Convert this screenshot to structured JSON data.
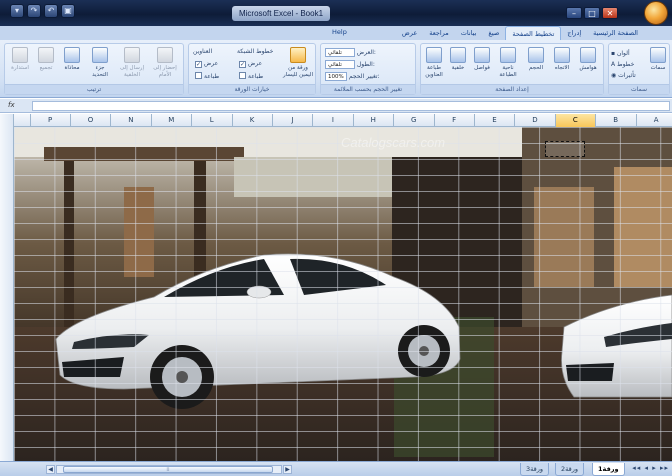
{
  "window": {
    "title": "Microsoft Excel - Book1",
    "title_visible": "Microsoft Excel - Book1"
  },
  "menu": {
    "help": "Help"
  },
  "tabs": [
    {
      "label": "الصفحة الرئيسية",
      "active": false
    },
    {
      "label": "إدراج",
      "active": false
    },
    {
      "label": "تخطيط الصفحة",
      "active": true
    },
    {
      "label": "صيغ",
      "active": false
    },
    {
      "label": "بيانات",
      "active": false
    },
    {
      "label": "مراجعة",
      "active": false
    },
    {
      "label": "عرض",
      "active": false
    }
  ],
  "ribbon": {
    "themes_group": {
      "label": "سمات",
      "btn_themes": "سمات",
      "colors": "ألوان",
      "fonts": "خطوط",
      "effects": "تأثيرات"
    },
    "page_setup": {
      "label": "إعداد الصفحة",
      "margins": "هوامش",
      "orientation": "الاتجاه",
      "size": "الحجم",
      "print_area": "ناحية الطباعة",
      "breaks": "فواصل",
      "background": "خلفية",
      "print_titles": "طباعة العناوين"
    },
    "scale": {
      "label": "تغيير الحجم بحسب الملائمة",
      "width_label": "العرض:",
      "width_value": "تلقائي",
      "height_label": "الطول:",
      "height_value": "تلقائي",
      "scale_label": "تغيير الحجم:",
      "scale_value": "100%"
    },
    "sheet_options": {
      "label": "خيارات الورقة",
      "gridlines": "خطوط الشبكة",
      "headings": "العناوين",
      "view": "عرض",
      "print": "طباعة",
      "gridlines_view": true,
      "gridlines_print": false,
      "headings_view": true,
      "headings_print": false,
      "sheet_rtl": "ورقة من اليمين لليسار"
    },
    "arrange": {
      "label": "ترتيب",
      "bring_front": "إحضار إلى الأمام",
      "send_back": "إرسال إلى الخلفية",
      "selection_pane": "جزء التحديد",
      "align": "محاذاة",
      "group": "تجميع",
      "rotate": "استدارة"
    }
  },
  "formula_bar": {
    "fx": "fx",
    "value": ""
  },
  "columns": [
    "A",
    "B",
    "C",
    "D",
    "E",
    "F",
    "G",
    "H",
    "I",
    "J",
    "K",
    "L",
    "M",
    "N",
    "O",
    "P"
  ],
  "selected_column": "C",
  "picture": {
    "watermark": "Catalogscars.com",
    "description_icon": "car-photo"
  },
  "sheets": [
    {
      "label": "ورقة1",
      "active": true
    },
    {
      "label": "ورقة2",
      "active": false
    },
    {
      "label": "ورقة3",
      "active": false
    }
  ],
  "colors": {
    "titlebar": "#0e1c38",
    "ribbon": "#d3e1f4",
    "selected_header": "#f8c659",
    "car_body": "#f1f2f3"
  }
}
